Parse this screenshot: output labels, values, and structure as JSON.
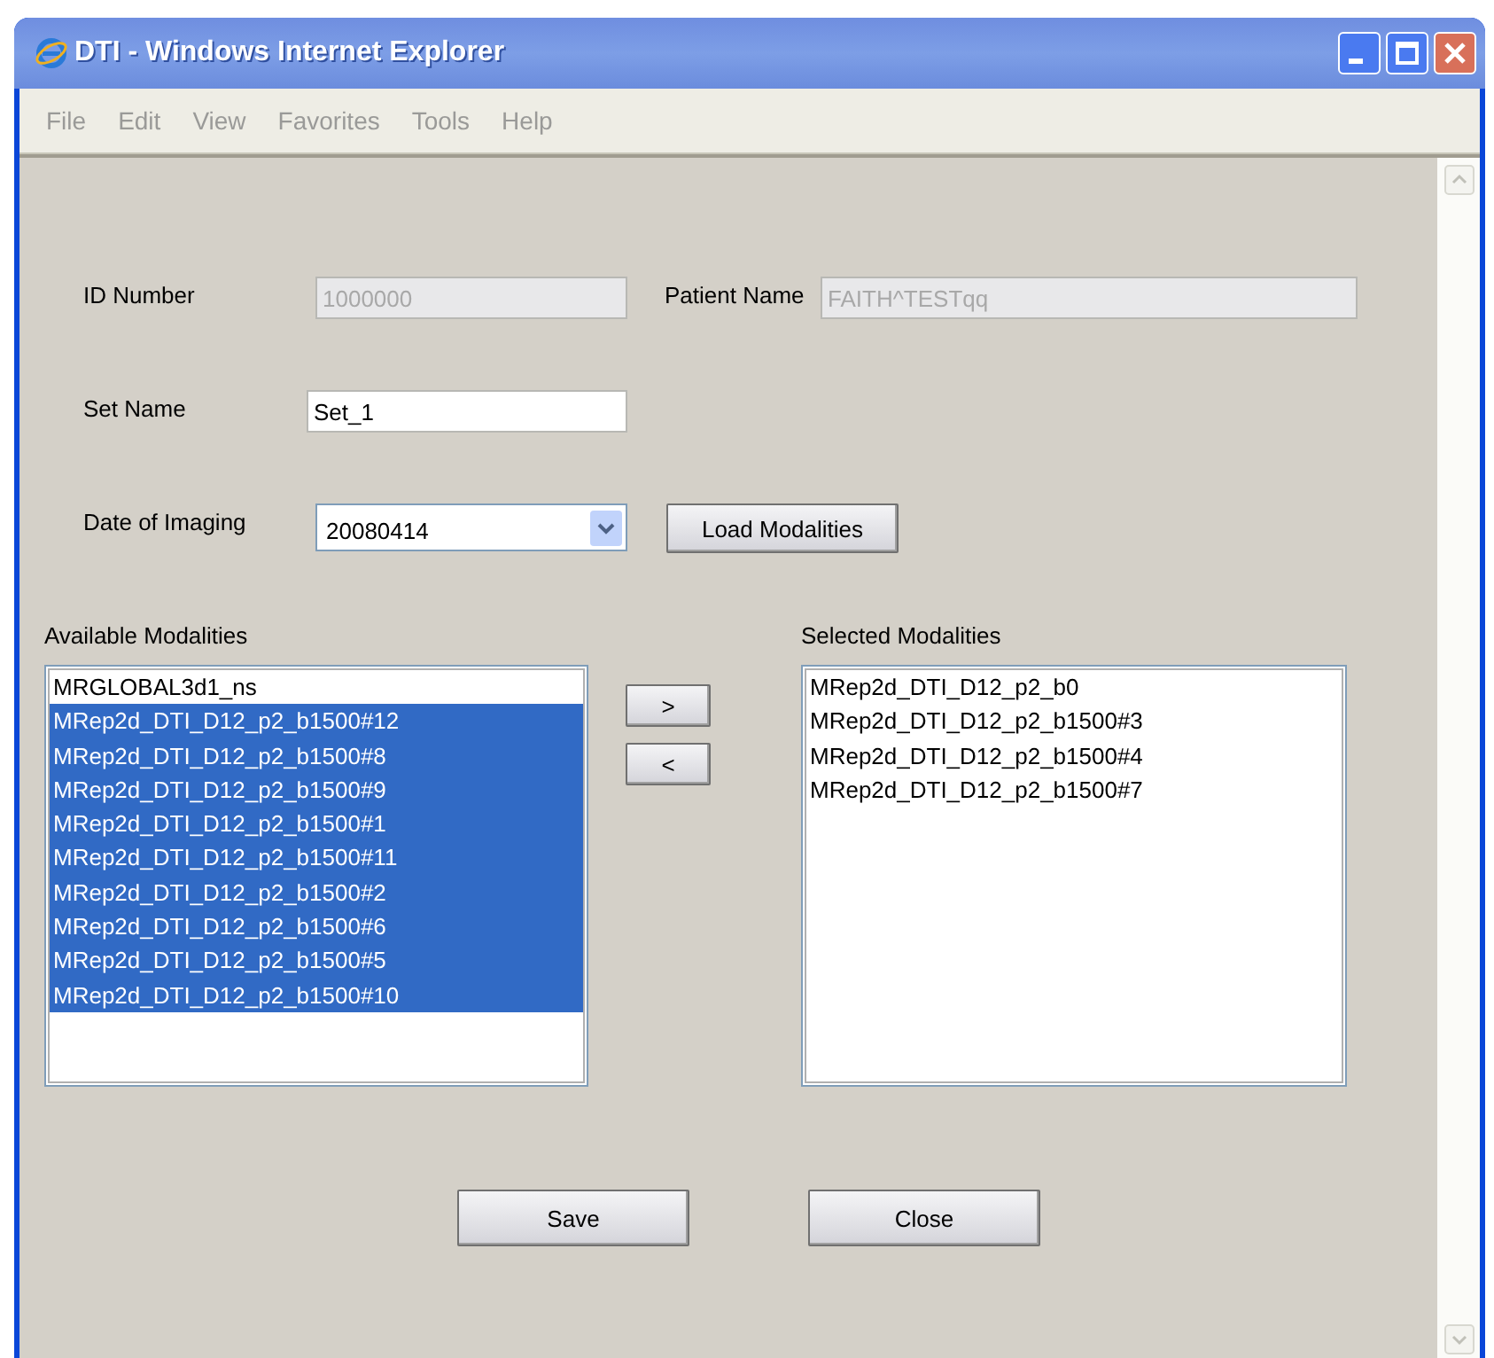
{
  "window": {
    "title": "DTI - Windows Internet Explorer"
  },
  "menu": [
    "File",
    "Edit",
    "View",
    "Favorites",
    "Tools",
    "Help"
  ],
  "id_number": {
    "label": "ID Number",
    "value": "1000000",
    "disabled": true
  },
  "patient_name": {
    "label": "Patient Name",
    "value": "FAITH^TESTqq",
    "disabled": true
  },
  "set_name": {
    "label": "Set Name",
    "value": "Set_1",
    "disabled": false
  },
  "date_of_imaging": {
    "label": "Date of Imaging",
    "value": "20080414"
  },
  "load_button": "Load Modalities",
  "available": {
    "label": "Available Modalities",
    "items": [
      {
        "text": "MRGLOBAL3d1_ns",
        "selected": false
      },
      {
        "text": "MRep2d_DTI_D12_p2_b1500#12",
        "selected": true
      },
      {
        "text": "MRep2d_DTI_D12_p2_b1500#8",
        "selected": true
      },
      {
        "text": "MRep2d_DTI_D12_p2_b1500#9",
        "selected": true
      },
      {
        "text": "MRep2d_DTI_D12_p2_b1500#1",
        "selected": true
      },
      {
        "text": "MRep2d_DTI_D12_p2_b1500#11",
        "selected": true
      },
      {
        "text": "MRep2d_DTI_D12_p2_b1500#2",
        "selected": true
      },
      {
        "text": "MRep2d_DTI_D12_p2_b1500#6",
        "selected": true
      },
      {
        "text": "MRep2d_DTI_D12_p2_b1500#5",
        "selected": true
      },
      {
        "text": "MRep2d_DTI_D12_p2_b1500#10",
        "selected": true
      }
    ]
  },
  "move_buttons": [
    ">",
    "<"
  ],
  "selected": {
    "label": "Selected Modalities",
    "items": [
      {
        "text": "MRep2d_DTI_D12_p2_b0",
        "selected": false
      },
      {
        "text": "MRep2d_DTI_D12_p2_b1500#3",
        "selected": false
      },
      {
        "text": "MRep2d_DTI_D12_p2_b1500#4",
        "selected": false
      },
      {
        "text": "MRep2d_DTI_D12_p2_b1500#7",
        "selected": false
      }
    ]
  },
  "footer_buttons": [
    "Save",
    "Close"
  ]
}
